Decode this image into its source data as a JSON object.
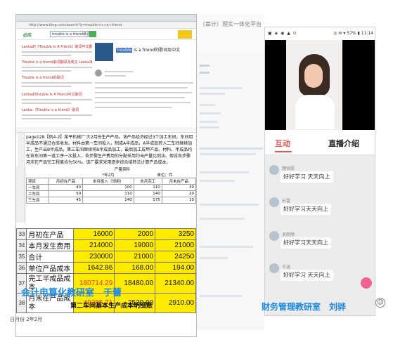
{
  "left": {
    "address": "http://www.bing.com/search?q=trouble+is+a+friend",
    "bing_logo": "必应",
    "search_query": "trouble is a friend歌词",
    "results": [
      {
        "title": "Lenka的《Trouble Is A Friend》歌词中文翻译"
      },
      {
        "title": "Trouble is a friend歌词翻译及英文 Lenka演唱"
      },
      {
        "title": "Trouble is a friend的歌词"
      },
      {
        "title": "Lenka的Trouble Is A Friend中文歌词"
      },
      {
        "title": "Lenka 《Trouble is a friend》歌词"
      }
    ],
    "card_title_highlight": "trouble",
    "card_title_rest": " is a friend的歌词及中文",
    "problem_text": "page128【例4-2】某平机械厂'大2月份生产产品。该产品经济经过3个加工车间。车间用半成品不通过仓库收发。材料由第一车间投入，制成A半成品，A半成品转入二车间继续加工，生产出B半成品，第三车间继续将B半成品加工，最后加工成甲产品。材料、半成品均在各车间第一道工序一次投入，各步骤生产费用的分配采用约当产量比例法。假设各步骤月末在产品完工程度均为50%。该厂要求采用逐步综合结转法计算产品成本。",
    "prod_table": {
      "title": "产量资料",
      "date": "*年2月",
      "unit": "单位：件",
      "headers": [
        "项目",
        "月初在产品",
        "本月投入（领用）",
        "本月完工",
        "月末在产品"
      ],
      "rows": [
        {
          "item": "一车间",
          "v": [
            "40",
            "100",
            "110",
            "30"
          ]
        },
        {
          "item": "二车间",
          "v": [
            "50",
            "110",
            "140",
            "20"
          ]
        },
        {
          "item": "三车间",
          "v": [
            "45",
            "140",
            "175",
            "10"
          ]
        }
      ]
    },
    "cost_rows": [
      {
        "num": "33",
        "label": "月初在产品",
        "v": [
          "16000",
          "2000",
          "3250"
        ]
      },
      {
        "num": "34",
        "label": "本月发生费用",
        "v": [
          "214000",
          "19000",
          "21000"
        ]
      },
      {
        "num": "35",
        "label": "合计",
        "v": [
          "230000",
          "21000",
          "24250"
        ]
      },
      {
        "num": "36",
        "label": "单位产品成本",
        "v": [
          "1642.86",
          "168.00",
          "194.00"
        ]
      },
      {
        "num": "37",
        "label": "完工半成品成本",
        "v": [
          "180714.29",
          "18480.00",
          "21340.00"
        ]
      },
      {
        "num": "38",
        "label": "月末在产品成本",
        "v": [
          "49285.71",
          "2520.00",
          "2910.00"
        ]
      }
    ],
    "caption": "会计电算化教研室　于蕾",
    "subtitle": "第二车间基本生产成本明细账",
    "bottom_row": "日月份  2年2月"
  },
  "middle": {
    "title": "〔审计〕理实一体化平台"
  },
  "right": {
    "status_left": "▣ ◈ ◉ ▲ ⊙",
    "status_right": "◎ ✉ ▾ 57% ▮ 11:14",
    "tab_interactive": "互动",
    "tab_intro": "直播介绍",
    "messages": [
      {
        "name": "魏锐霞",
        "text": "好好学习 天天向上"
      },
      {
        "name": "石雷",
        "text": "好好学习天天向上"
      },
      {
        "name": "吴丽丽",
        "text": "好好学习天天向上"
      },
      {
        "name": "王涵",
        "text": "好好学习 天天向上"
      }
    ],
    "caption": "财务管理教研室　刘骅",
    "smile": "☺"
  }
}
